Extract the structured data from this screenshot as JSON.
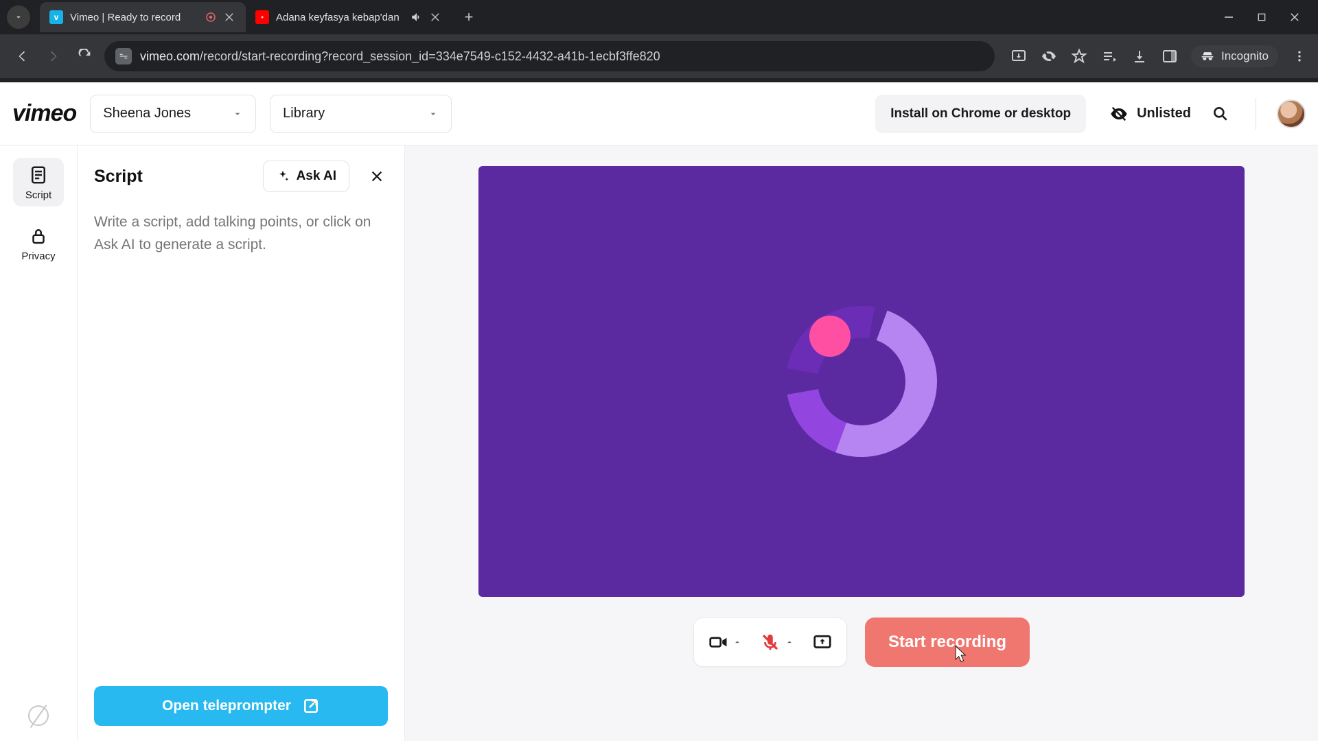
{
  "browser": {
    "tabs": [
      {
        "title": "Vimeo | Ready to record",
        "favicon": "vimeo",
        "active": true,
        "recording_indicator": true
      },
      {
        "title": "Adana keyfasya kebap'dan",
        "favicon": "youtube",
        "active": false,
        "audio_indicator": true
      }
    ],
    "url_domain": "vimeo.com",
    "url_path": "/record/start-recording?record_session_id=334e7549-c152-4432-a41b-1ecbf3ffe820",
    "incognito_label": "Incognito"
  },
  "header": {
    "user_select": "Sheena Jones",
    "library_select": "Library",
    "install_label": "Install on Chrome or desktop",
    "visibility_label": "Unlisted"
  },
  "rail": {
    "items": [
      {
        "label": "Script",
        "active": true
      },
      {
        "label": "Privacy",
        "active": false
      }
    ]
  },
  "script_panel": {
    "title": "Script",
    "ask_ai_label": "Ask AI",
    "placeholder": "Write a script, add talking points, or click on Ask AI to generate a script.",
    "teleprompter_label": "Open teleprompter"
  },
  "controls": {
    "start_label": "Start recording"
  }
}
